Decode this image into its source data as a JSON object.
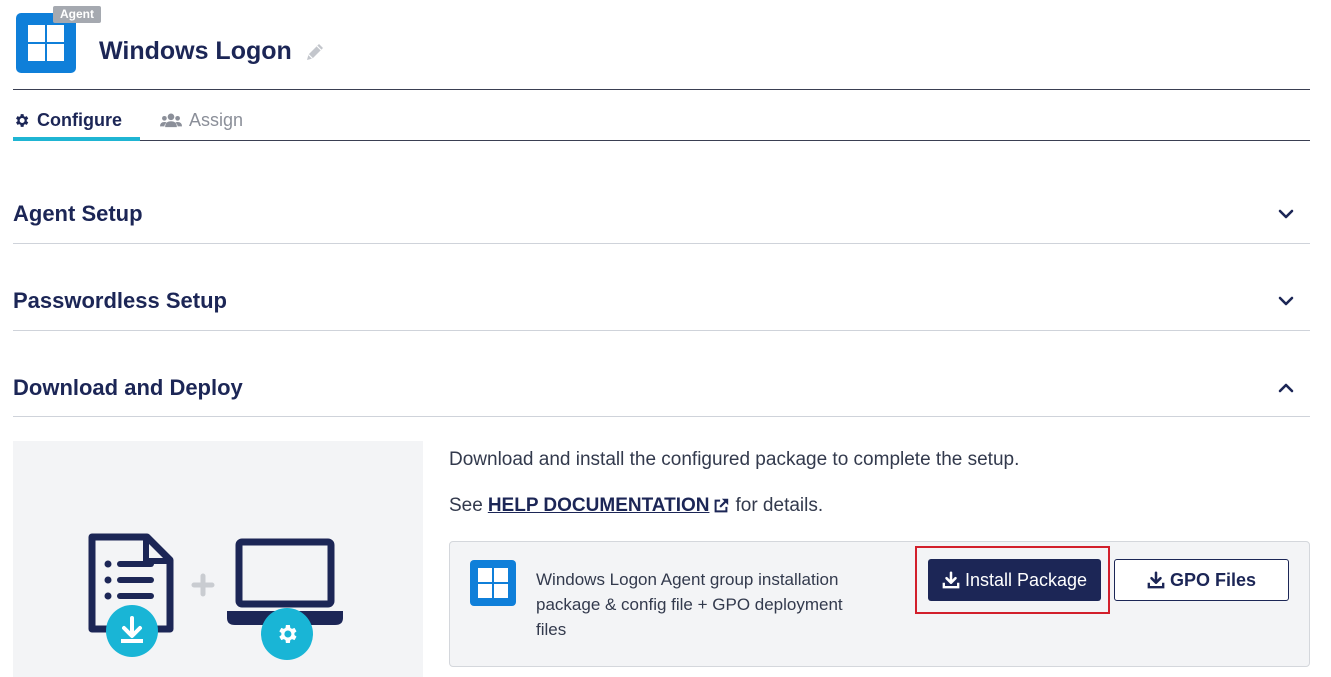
{
  "header": {
    "badge": "Agent",
    "title": "Windows Logon",
    "logo_icon": "windows-logo-icon",
    "edit_icon": "pencil-icon"
  },
  "tabs": [
    {
      "label": "Configure",
      "icon": "gear-icon",
      "active": true
    },
    {
      "label": "Assign",
      "icon": "users-icon",
      "active": false
    }
  ],
  "sections": [
    {
      "title": "Agent Setup",
      "expanded": false
    },
    {
      "title": "Passwordless Setup",
      "expanded": false
    },
    {
      "title": "Download and Deploy",
      "expanded": true
    }
  ],
  "deploy": {
    "intro": "Download and install the configured package to complete the setup.",
    "see_prefix": "See",
    "help_link": "HELP DOCUMENTATION",
    "see_suffix": "for details.",
    "package_description": "Windows Logon Agent group installation package & config file + GPO deployment files",
    "install_button": "Install Package",
    "gpo_button": "GPO Files"
  },
  "colors": {
    "brand_navy": "#1c2656",
    "windows_blue": "#0f7fd9",
    "tab_accent": "#1fb5d3",
    "illustration_cyan": "#19b5d6",
    "highlight_red": "#d21f2b"
  }
}
